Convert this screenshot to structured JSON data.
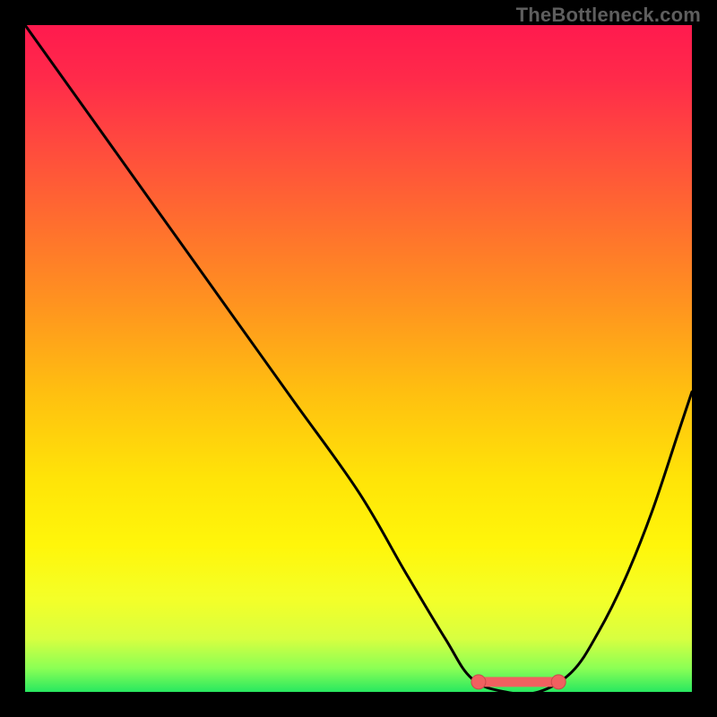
{
  "watermark": {
    "text": "TheBottleneck.com"
  },
  "colors": {
    "background": "#000000",
    "watermark": "#5e5e5e",
    "curve": "#000000",
    "marker_fill": "#f06060",
    "marker_stroke": "#c94a4a",
    "gradient_stops": [
      {
        "offset": 0.0,
        "color": "#ff1a4e"
      },
      {
        "offset": 0.08,
        "color": "#ff2a4a"
      },
      {
        "offset": 0.18,
        "color": "#ff4a3e"
      },
      {
        "offset": 0.3,
        "color": "#ff6f2e"
      },
      {
        "offset": 0.42,
        "color": "#ff941f"
      },
      {
        "offset": 0.55,
        "color": "#ffbf10"
      },
      {
        "offset": 0.68,
        "color": "#ffe408"
      },
      {
        "offset": 0.78,
        "color": "#fff60a"
      },
      {
        "offset": 0.86,
        "color": "#f4ff28"
      },
      {
        "offset": 0.92,
        "color": "#d8ff40"
      },
      {
        "offset": 0.965,
        "color": "#8aff55"
      },
      {
        "offset": 1.0,
        "color": "#28e860"
      }
    ]
  },
  "chart_data": {
    "type": "line",
    "title": "",
    "xlabel": "",
    "ylabel": "",
    "xlim": [
      0,
      100
    ],
    "ylim": [
      0,
      100
    ],
    "grid": false,
    "series": [
      {
        "name": "bottleneck-curve",
        "x": [
          0,
          10,
          20,
          30,
          40,
          50,
          57,
          63,
          67,
          72,
          77,
          82,
          86,
          90,
          94,
          98,
          100
        ],
        "values": [
          100,
          86,
          72,
          58,
          44,
          30,
          18,
          8,
          2,
          0,
          0,
          3,
          9,
          17,
          27,
          39,
          45
        ]
      }
    ],
    "annotations": [
      {
        "name": "flat-region-start",
        "x": 68,
        "y": 1.5
      },
      {
        "name": "flat-region-end",
        "x": 80,
        "y": 1.5
      }
    ]
  }
}
